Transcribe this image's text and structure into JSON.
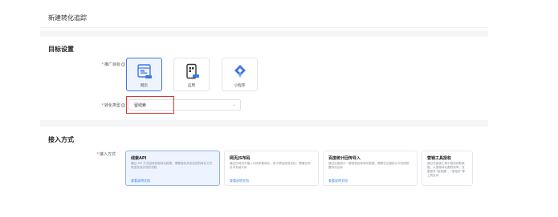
{
  "page": {
    "title": "新建转化追踪"
  },
  "target": {
    "section_title": "目标设置",
    "asset_label": "推广目标",
    "asset_types": [
      {
        "label": "网页",
        "icon": "webpage-icon",
        "selected": true
      },
      {
        "label": "应用",
        "icon": "app-icon",
        "selected": false
      },
      {
        "label": "小程序",
        "icon": "mini-program-icon",
        "selected": false
      }
    ],
    "conversion_label": "转化类型",
    "conversion_value": "留线索"
  },
  "access": {
    "section_title": "接入方式",
    "method_label": "接入方式",
    "methods": [
      {
        "title": "线索API",
        "desc": "通过 API 方式回传线索转化数据，需要接收并发送到的转化方式类型及适合您的流程",
        "link": "查看说明文档",
        "selected": true
      },
      {
        "title": "网页JS布码",
        "desc": "通过在网页中植入代码采集转化，用于精准投放优化，需要在网页中安装代码",
        "link": "查看说明文档",
        "selected": false
      },
      {
        "title": "百度统计回传导入",
        "desc": "通过百度统计一键授权回传转化数据，需要在百度统计中完成配置转化目标",
        "link": "查看说明文档",
        "selected": false
      },
      {
        "title": "营销工具授权",
        "desc": "通过在营销工具中授权获取数据，以提高转化跟踪效率，查看更多“营销通”、“落地页”等工具支持",
        "link": "",
        "selected": false
      }
    ]
  },
  "colors": {
    "accent": "#3a78e8",
    "highlight_border": "#d83a34",
    "required": "#e34d4d"
  }
}
